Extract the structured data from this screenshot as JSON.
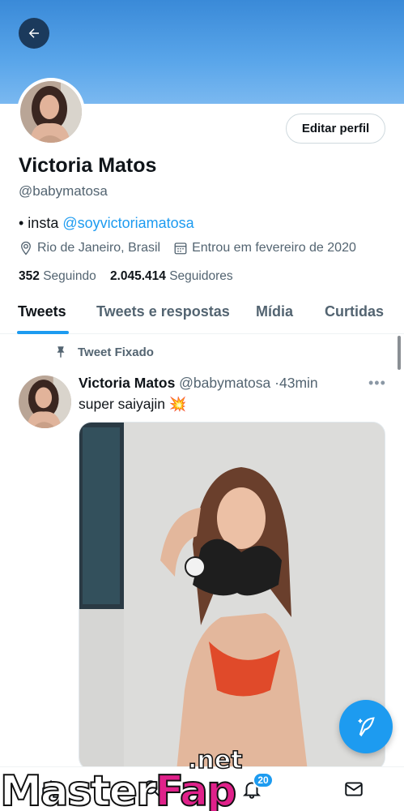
{
  "header": {
    "back_icon": "arrow-left-icon",
    "banner_color": "#4a9be3"
  },
  "profile": {
    "name": "Victoria Matos",
    "handle": "@babymatosa",
    "edit_label": "Editar perfil",
    "bio_prefix": "• insta ",
    "bio_link": "@soyvictoriamatosa",
    "location": "Rio de Janeiro, Brasil",
    "joined": "Entrou em fevereiro de 2020",
    "following_count": "352",
    "following_label": "Seguindo",
    "followers_count": "2.045.414",
    "followers_label": "Seguidores"
  },
  "tabs": [
    {
      "label": "Tweets",
      "active": true
    },
    {
      "label": "Tweets e respostas",
      "active": false
    },
    {
      "label": "Mídia",
      "active": false
    },
    {
      "label": "Curtidas",
      "active": false
    }
  ],
  "tweet": {
    "pinned_label": "Tweet Fixado",
    "author_name": "Victoria Matos",
    "author_handle": "@babymatosa",
    "separator": "·",
    "time": "43min",
    "text": "super saiyajin",
    "emoji": "💥",
    "more_icon": "more-dots-icon"
  },
  "bottom_nav": {
    "notifications_badge": "20",
    "items": [
      "home-icon",
      "search-icon",
      "notifications-icon",
      "messages-icon"
    ]
  },
  "compose_icon": "compose-feather-icon",
  "watermark": {
    "main_left": "Master",
    "main_right": "Fap",
    "suffix": ".net"
  },
  "colors": {
    "accent": "#1d9bf0",
    "text": "#0f1419",
    "secondary": "#536471"
  }
}
